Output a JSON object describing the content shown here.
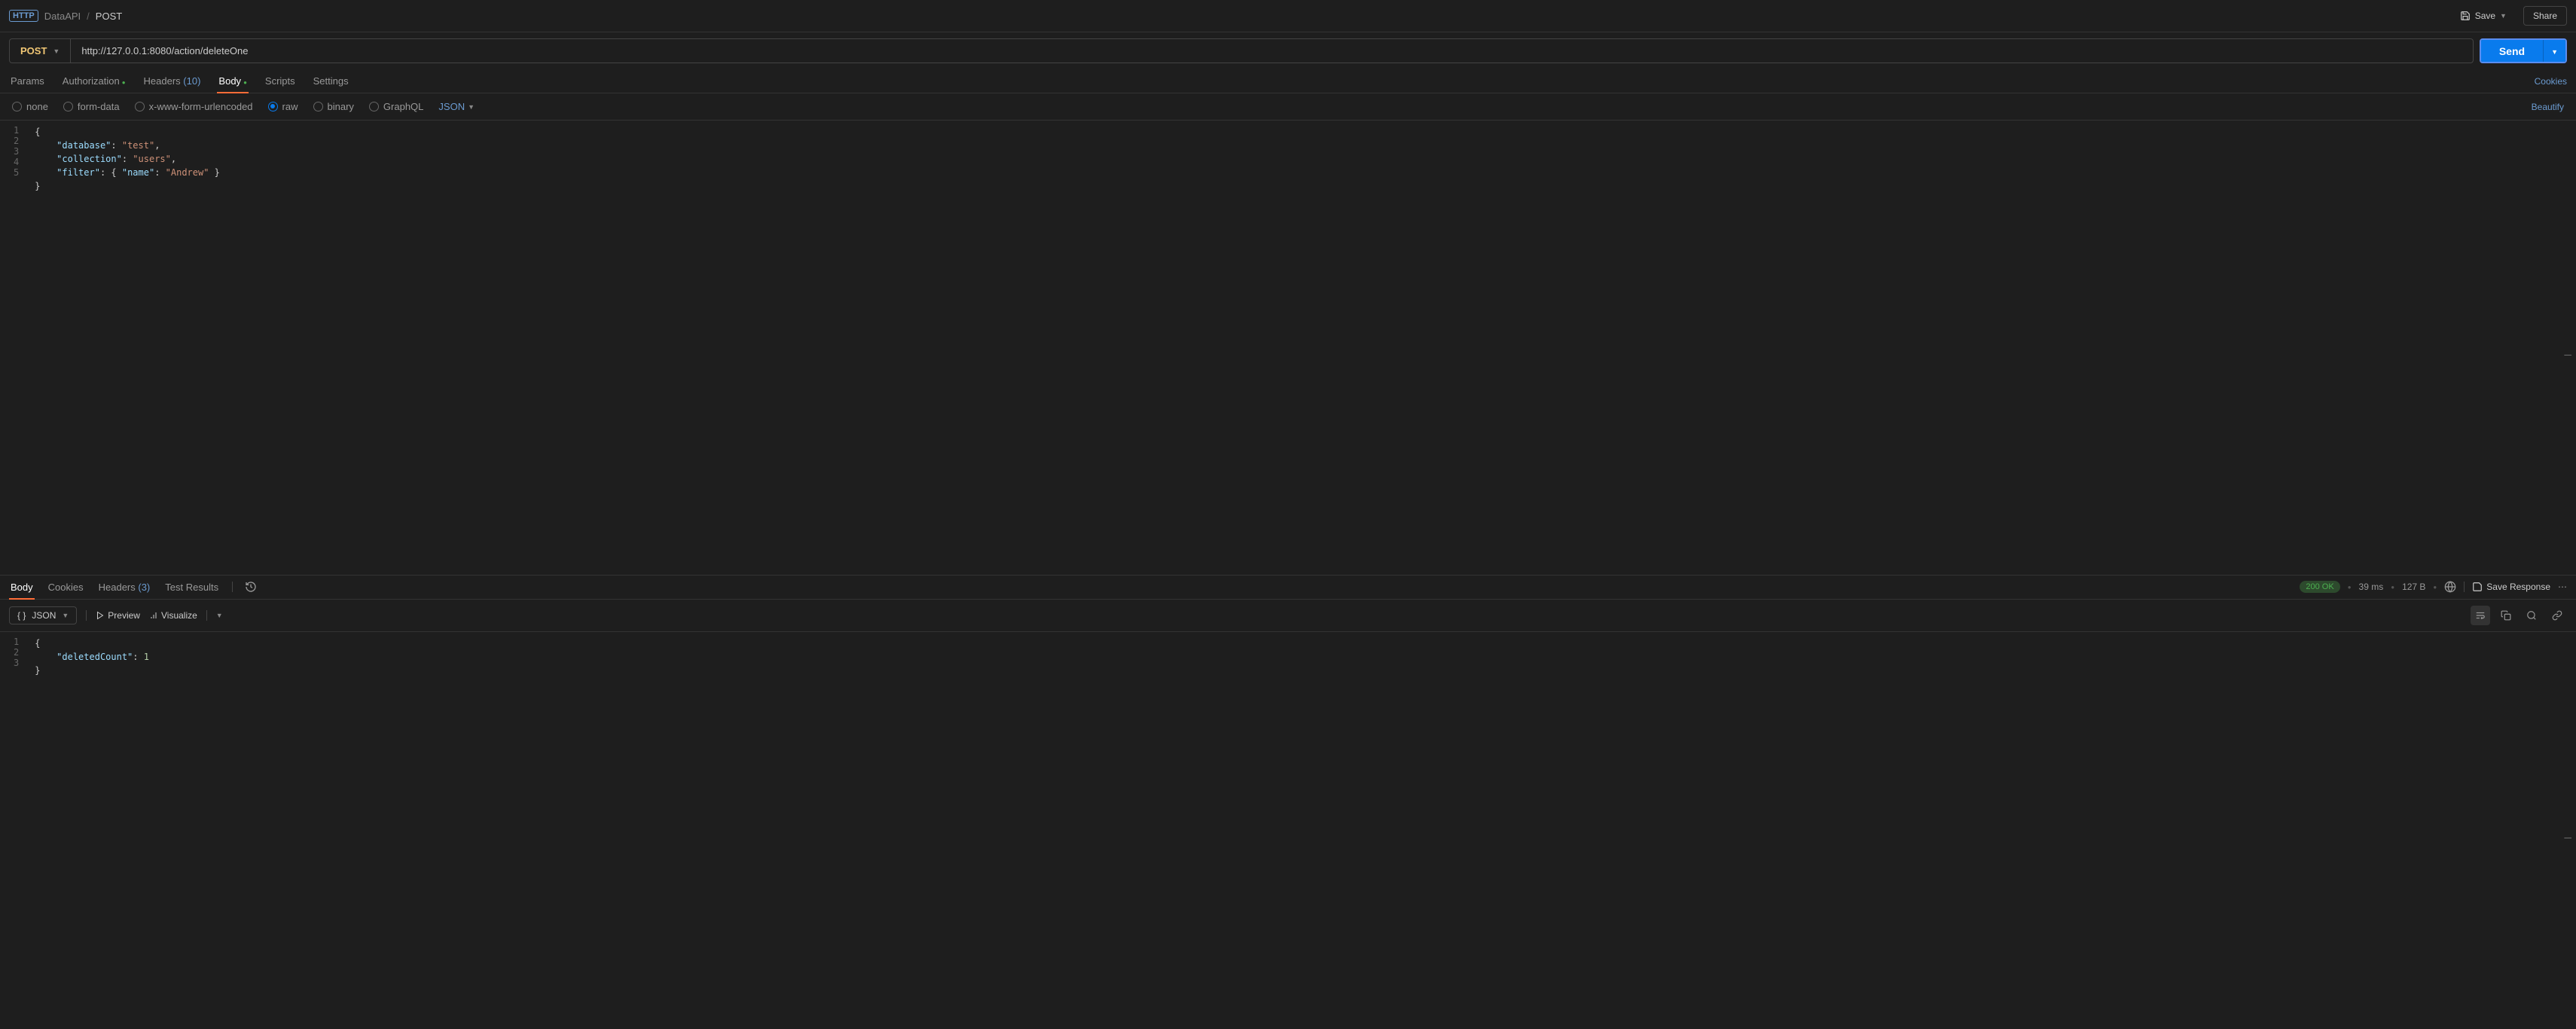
{
  "breadcrumb": {
    "workspace": "DataAPI",
    "separator": "/",
    "current": "POST"
  },
  "header_actions": {
    "save": "Save",
    "share": "Share"
  },
  "request": {
    "method": "POST",
    "url": "http://127.0.0.1:8080/action/deleteOne",
    "send": "Send"
  },
  "req_tabs": {
    "params": "Params",
    "authorization": "Authorization",
    "headers_label": "Headers",
    "headers_count": "(10)",
    "body": "Body",
    "scripts": "Scripts",
    "settings": "Settings",
    "cookies": "Cookies"
  },
  "body_types": {
    "none": "none",
    "form_data": "form-data",
    "urlencoded": "x-www-form-urlencoded",
    "raw": "raw",
    "binary": "binary",
    "graphql": "GraphQL",
    "format": "JSON",
    "beautify": "Beautify"
  },
  "req_body": {
    "lines": [
      "1",
      "2",
      "3",
      "4",
      "5"
    ],
    "l1": "{",
    "l2_k": "\"database\"",
    "l2_v": "\"test\"",
    "l3_k": "\"collection\"",
    "l3_v": "\"users\"",
    "l4_k": "\"filter\"",
    "l4_nk": "\"name\"",
    "l4_nv": "\"Andrew\"",
    "l5": "}"
  },
  "res_tabs": {
    "body": "Body",
    "cookies": "Cookies",
    "headers_label": "Headers",
    "headers_count": "(3)",
    "test_results": "Test Results"
  },
  "res_status": {
    "code": "200 OK",
    "time": "39 ms",
    "size": "127 B",
    "save_response": "Save Response"
  },
  "res_toolbar": {
    "format": "JSON",
    "preview": "Preview",
    "visualize": "Visualize"
  },
  "res_body": {
    "lines": [
      "1",
      "2",
      "3"
    ],
    "l1": "{",
    "l2_k": "\"deletedCount\"",
    "l2_v": "1",
    "l3": "}"
  }
}
